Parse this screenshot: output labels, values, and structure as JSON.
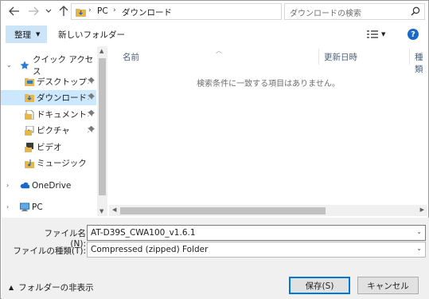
{
  "address": {
    "path": [
      "PC",
      "ダウンロード"
    ]
  },
  "search": {
    "placeholder": "ダウンロードの検索"
  },
  "toolbar": {
    "organize_label": "整理",
    "new_folder_label": "新しいフォルダー"
  },
  "nav": {
    "quick_access": "クイック アクセス",
    "items": [
      {
        "label": "デスクトップ",
        "icon": "desktop-folder-icon",
        "pinned": true
      },
      {
        "label": "ダウンロード",
        "icon": "download-folder-icon",
        "pinned": true,
        "selected": true
      },
      {
        "label": "ドキュメント",
        "icon": "documents-folder-icon",
        "pinned": true
      },
      {
        "label": "ピクチャ",
        "icon": "pictures-folder-icon",
        "pinned": true
      },
      {
        "label": "ビデオ",
        "icon": "videos-folder-icon",
        "pinned": false
      },
      {
        "label": "ミュージック",
        "icon": "music-folder-icon",
        "pinned": false
      }
    ],
    "onedrive": "OneDrive",
    "pc": "PC"
  },
  "file_list": {
    "columns": [
      "名前",
      "更新日時",
      "種類"
    ],
    "empty_message": "検索条件に一致する項目はありません。"
  },
  "form": {
    "filename_label": "ファイル名(N):",
    "filename_value": "AT-D39S_CWA100_v1.6.1",
    "filetype_label": "ファイルの種類(T):",
    "filetype_value": "Compressed (zipped) Folder"
  },
  "footer": {
    "hide_folders_label": "フォルダーの非表示",
    "save_label": "保存(S)",
    "cancel_label": "キャンセル"
  },
  "colors": {
    "accent": "#0078d7",
    "selection": "#cce8ff",
    "organize_bg": "#cce4f7"
  }
}
